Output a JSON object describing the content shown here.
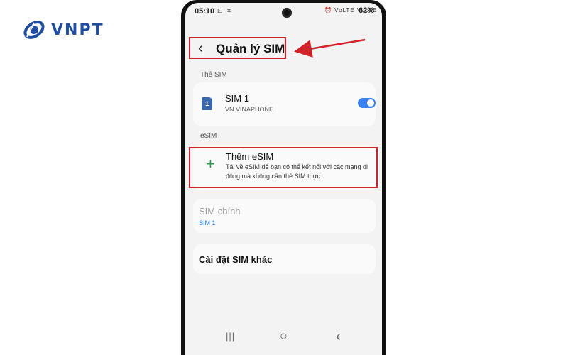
{
  "brand": {
    "name": "VNPT",
    "color": "#1f4ea1"
  },
  "status_bar": {
    "time": "05:10",
    "left_icons": "⊡ ⌗",
    "right_icons": "⏰ VoLTE VoLTE",
    "battery": "62%"
  },
  "header": {
    "back_icon": "chevron-left-icon",
    "title": "Quản lý SIM"
  },
  "sections": {
    "sim_label": "Thẻ SIM",
    "esim_label": "eSIM"
  },
  "sim1": {
    "icon_number": "1",
    "name": "SIM 1",
    "carrier": "VN VINAPHONE",
    "enabled": true
  },
  "add_esim": {
    "title": "Thêm eSIM",
    "description": "Tải về eSIM để bạn có thể kết nối với các mạng di động mà không cần thẻ SIM thực."
  },
  "primary_sim": {
    "label": "SIM chính",
    "value": "SIM 1"
  },
  "other_settings": {
    "label": "Cài đặt SIM khác"
  },
  "nav": {
    "recent": "|||",
    "home": "○",
    "back": "‹"
  },
  "colors": {
    "highlight": "#d0232a",
    "toggle": "#3b82f0",
    "accent_text": "#1a73e8",
    "plus": "#2c9a48"
  }
}
